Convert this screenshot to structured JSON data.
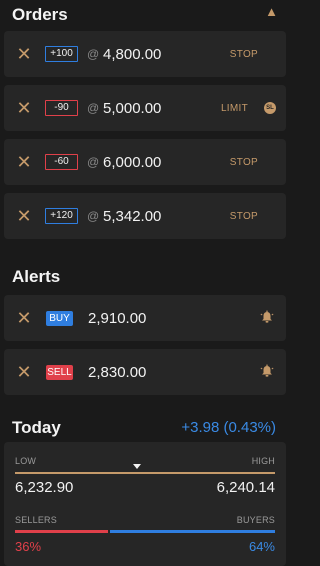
{
  "orders": {
    "title": "Orders",
    "collapse_icon": "chevron-up-icon",
    "items": [
      {
        "qty": "+100",
        "side": "buy",
        "at": "@",
        "price": "4,800.00",
        "type": "STOP"
      },
      {
        "qty": "-90",
        "side": "sell",
        "at": "@",
        "price": "5,000.00",
        "type": "LIMIT",
        "badge": "SL"
      },
      {
        "qty": "-60",
        "side": "sell",
        "at": "@",
        "price": "6,000.00",
        "type": "STOP"
      },
      {
        "qty": "+120",
        "side": "buy",
        "at": "@",
        "price": "5,342.00",
        "type": "STOP"
      }
    ]
  },
  "alerts": {
    "title": "Alerts",
    "items": [
      {
        "tag": "BUY",
        "price": "2,910.00",
        "icon": "bell-icon"
      },
      {
        "tag": "SELL",
        "price": "2,830.00",
        "icon": "bell-icon"
      }
    ]
  },
  "today": {
    "title": "Today",
    "change": "+3.98 (0.43%)",
    "low_label": "LOW",
    "high_label": "HIGH",
    "low": "6,232.90",
    "high": "6,240.14",
    "current_position_fraction": 0.47,
    "sellers_label": "SELLERS",
    "buyers_label": "BUYERS",
    "sellers_pct": "36%",
    "buyers_pct": "64%",
    "sellers_fraction": 0.36
  },
  "colors": {
    "accent": "#c59a6a",
    "buy": "#2f7ee0",
    "sell": "#e0404a",
    "background": "#1a1a1a",
    "card": "#262626"
  }
}
